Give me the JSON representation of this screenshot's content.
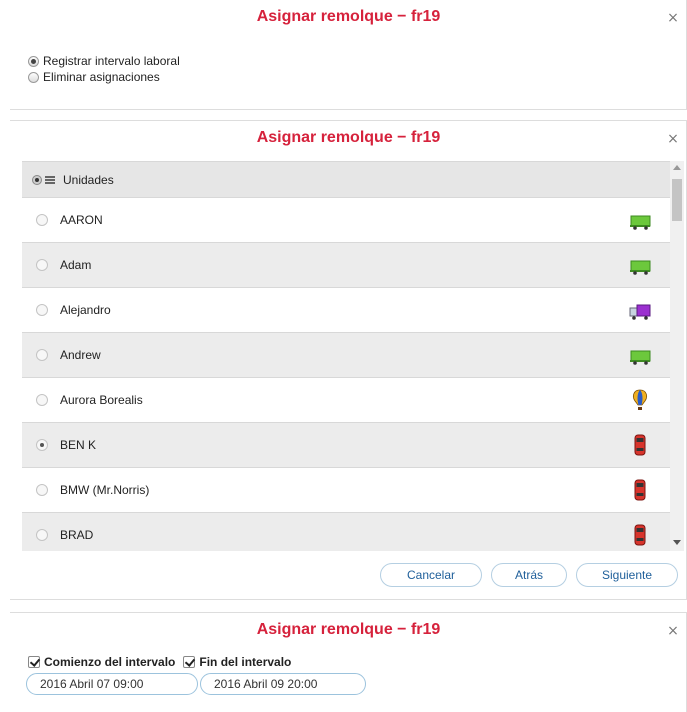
{
  "dialog_title": "Asignar remolque − fr19",
  "close_glyph": "×",
  "step1": {
    "options": [
      {
        "label": "Registrar intervalo laboral",
        "selected": true
      },
      {
        "label": "Eliminar asignaciones",
        "selected": false
      }
    ]
  },
  "step2": {
    "header_label": "Unidades",
    "units": [
      {
        "name": "AARON",
        "icon": "truck-green-icon",
        "selected": false
      },
      {
        "name": "Adam",
        "icon": "truck-green-icon",
        "selected": false
      },
      {
        "name": "Alejandro",
        "icon": "truck-purple-icon",
        "selected": false
      },
      {
        "name": "Andrew",
        "icon": "truck-green-icon",
        "selected": false
      },
      {
        "name": "Aurora Borealis",
        "icon": "hot-air-balloon-icon",
        "selected": false
      },
      {
        "name": "BEN K",
        "icon": "car-red-icon",
        "selected": true
      },
      {
        "name": "BMW (Mr.Norris)",
        "icon": "car-red-icon",
        "selected": false
      },
      {
        "name": "BRAD",
        "icon": "car-red-icon",
        "selected": false
      }
    ],
    "buttons": {
      "cancel": "Cancelar",
      "back": "Atrás",
      "next": "Siguiente"
    }
  },
  "step3": {
    "start_label": "Comienzo del intervalo",
    "end_label": "Fin del intervalo",
    "start_value": "2016 Abril 07 09:00",
    "end_value": "2016 Abril 09 20:00"
  },
  "colors": {
    "title": "#d6223c",
    "button_text": "#1f5f9a",
    "alt_row": "#ececec"
  }
}
